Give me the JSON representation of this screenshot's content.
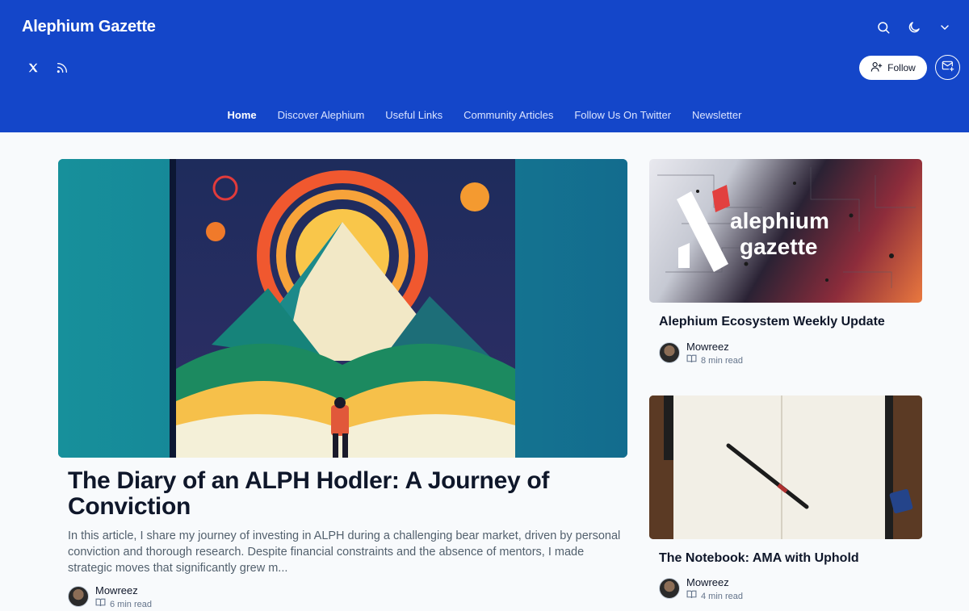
{
  "header": {
    "site_title": "Alephium Gazette",
    "icons": [
      "search-icon",
      "moon-icon",
      "chevron-down-icon"
    ],
    "social_icons": [
      "x-icon",
      "rss-icon"
    ],
    "follow_label": "Follow",
    "brand_color": "#1446c9"
  },
  "nav": {
    "items": [
      "Home",
      "Discover Alephium",
      "Useful Links",
      "Community Articles",
      "Follow Us On Twitter",
      "Newsletter"
    ],
    "active": "Home"
  },
  "featured": {
    "title": "The Diary of an ALPH Hodler: A Journey of Conviction",
    "excerpt": "In this article, I share my journey of investing in ALPH during a challenging bear market, driven by personal conviction and thorough research. Despite financial constraints and the absence of mentors, I made strategic moves that significantly grew m...",
    "author": "Mowreez",
    "read_time": "6 min read"
  },
  "side_posts": [
    {
      "title": "Alephium Ecosystem Weekly Update",
      "author": "Mowreez",
      "read_time": "8 min read",
      "image_text": [
        "alephium",
        "gazette"
      ]
    },
    {
      "title": "The Notebook: AMA with Uphold",
      "author": "Mowreez",
      "read_time": "4 min read"
    }
  ]
}
